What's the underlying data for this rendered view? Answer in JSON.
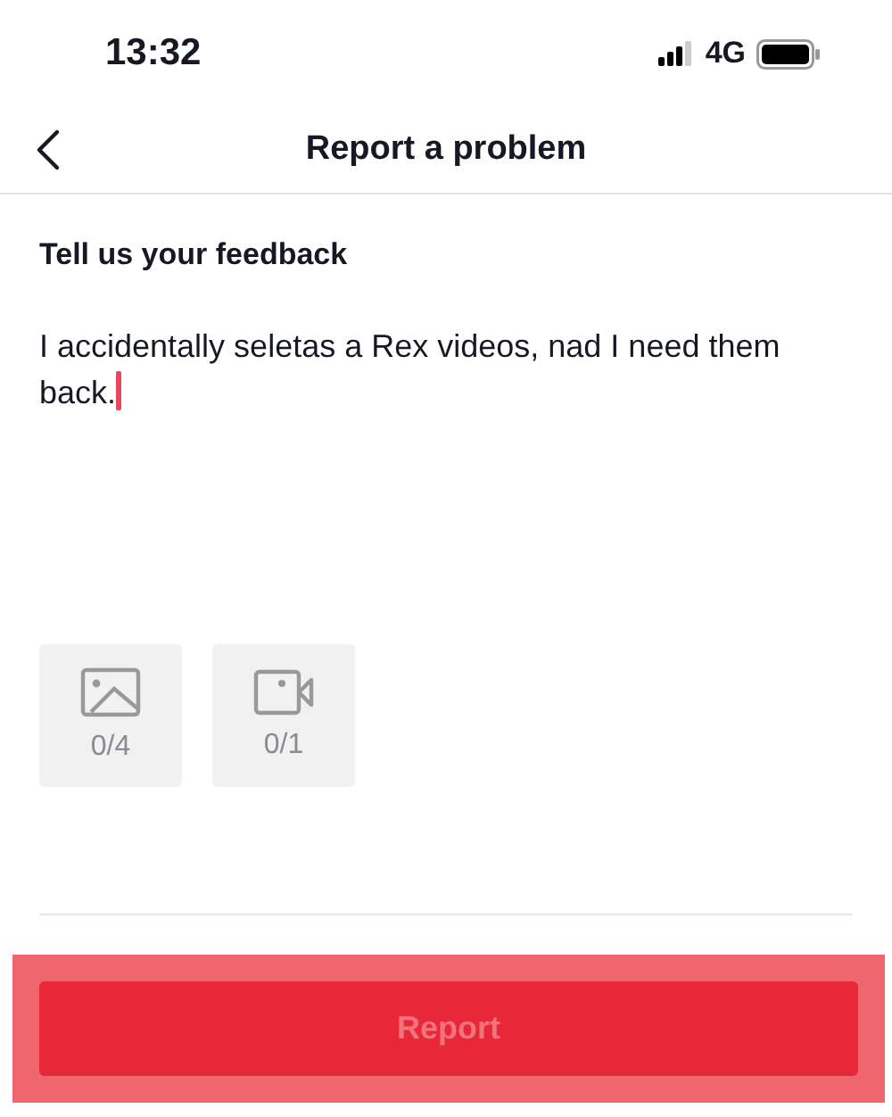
{
  "status_bar": {
    "time": "13:32",
    "network": "4G"
  },
  "nav": {
    "title": "Report a problem"
  },
  "feedback": {
    "label": "Tell us your feedback",
    "value": "I accidentally seletas a Rex videos, nad I need them back."
  },
  "attachments": [
    {
      "kind": "image",
      "count": "0/4"
    },
    {
      "kind": "video",
      "count": "0/1"
    }
  ],
  "report_button": {
    "label": "Report",
    "disabled": true,
    "highlighted": true
  }
}
